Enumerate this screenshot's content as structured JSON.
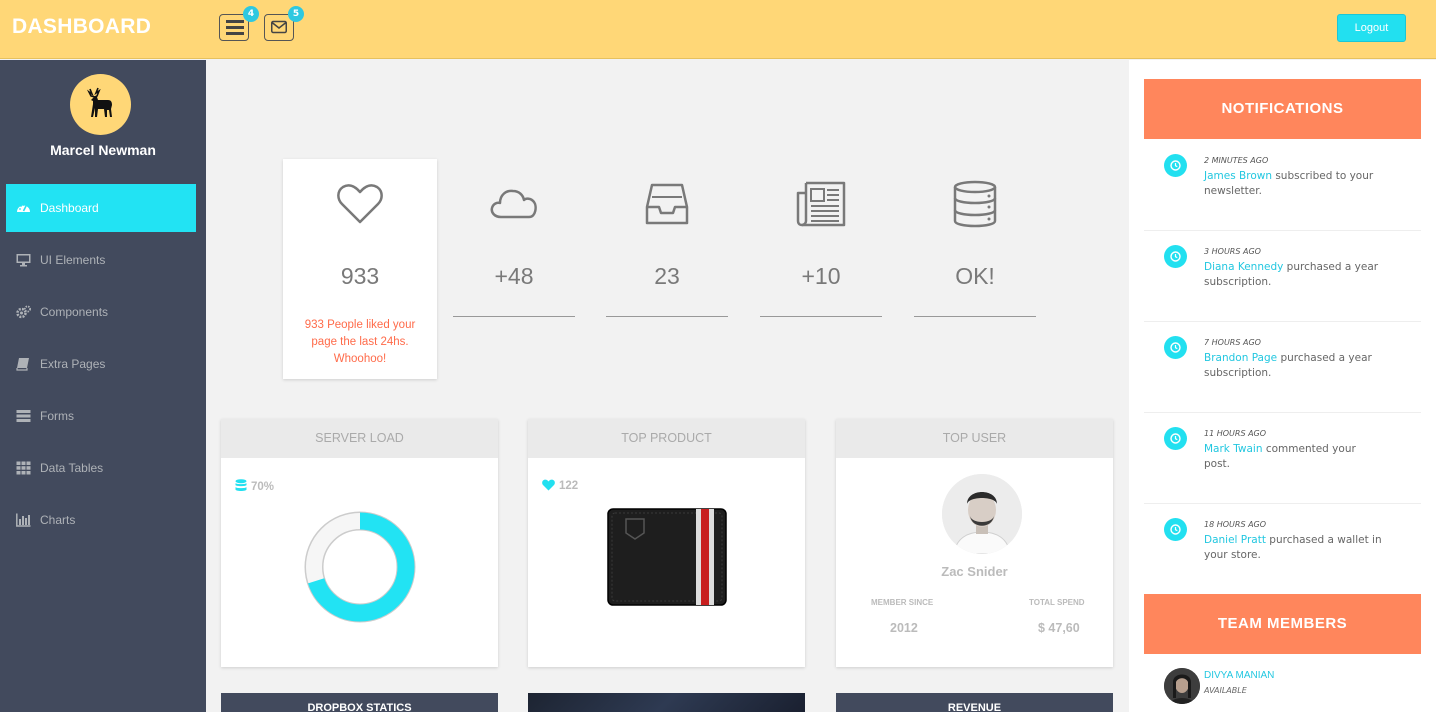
{
  "header": {
    "logo": "DASHBOARD",
    "tasks_badge": "4",
    "mail_badge": "5",
    "logout_label": "Logout"
  },
  "sidebar": {
    "username": "Marcel Newman",
    "items": [
      {
        "label": "Dashboard",
        "icon": "dashboard-icon",
        "active": true
      },
      {
        "label": "UI Elements",
        "icon": "desktop-icon"
      },
      {
        "label": "Components",
        "icon": "cogs-icon"
      },
      {
        "label": "Extra Pages",
        "icon": "book-icon"
      },
      {
        "label": "Forms",
        "icon": "tasks-icon"
      },
      {
        "label": "Data Tables",
        "icon": "grid-icon"
      },
      {
        "label": "Charts",
        "icon": "bar-chart-icon"
      }
    ]
  },
  "stats": [
    {
      "icon": "heart-icon",
      "value": "933",
      "desc": "933 People liked your page the last 24hs. Whoohoo!"
    },
    {
      "icon": "cloud-icon",
      "value": "+48"
    },
    {
      "icon": "inbox-icon",
      "value": "23"
    },
    {
      "icon": "newspaper-icon",
      "value": "+10"
    },
    {
      "icon": "database-icon",
      "value": "OK!"
    }
  ],
  "cards": {
    "server_load": {
      "title": "SERVER LOAD",
      "value": "70%",
      "percent": 0.7
    },
    "top_product": {
      "title": "TOP PRODUCT",
      "likes": "122"
    },
    "top_user": {
      "title": "TOP USER",
      "name": "Zac Snider",
      "member_since_label": "MEMBER SINCE",
      "member_since": "2012",
      "total_spend_label": "TOTAL SPEND",
      "total_spend": "$ 47,60"
    }
  },
  "bottom_cards": [
    "DROPBOX STATICS",
    "",
    "REVENUE"
  ],
  "notifications": {
    "title": "NOTIFICATIONS",
    "items": [
      {
        "time": "2 MINUTES AGO",
        "name": "James Brown",
        "text": " subscribed to your newsletter."
      },
      {
        "time": "3 HOURS AGO",
        "name": "Diana Kennedy",
        "text": " purchased a year subscription."
      },
      {
        "time": "7 HOURS AGO",
        "name": "Brandon Page",
        "text": " purchased a year subscription."
      },
      {
        "time": "11 HOURS AGO",
        "name": "Mark Twain",
        "text": " commented your post."
      },
      {
        "time": "18 HOURS AGO",
        "name": "Daniel Pratt",
        "text": " purchased a wallet in your store."
      }
    ]
  },
  "team": {
    "title": "TEAM MEMBERS",
    "members": [
      {
        "name": "DIVYA MANIAN",
        "status": "AVAILABLE"
      }
    ]
  },
  "colors": {
    "header": "#ffd777",
    "sidebar": "#424a5d",
    "accent": "#22e3f3",
    "orange": "#ff865c"
  }
}
